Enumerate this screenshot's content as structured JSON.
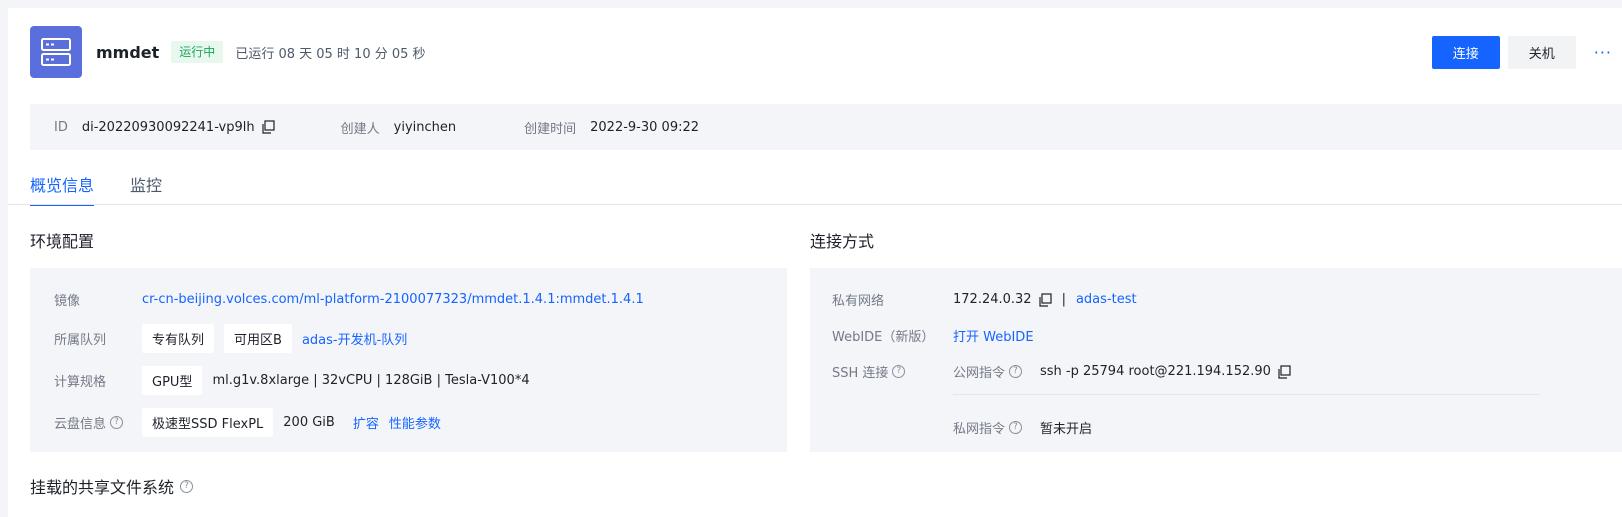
{
  "header": {
    "app_name": "mmdet",
    "status": "运行中",
    "uptime": "已运行 08 天 05 时 10 分 05 秒",
    "connect_label": "连接",
    "shutdown_label": "关机",
    "more_label": "···"
  },
  "meta": {
    "id_label": "ID",
    "id_value": "di-20220930092241-vp9lh",
    "creator_label": "创建人",
    "creator_value": "yiyinchen",
    "created_label": "创建时间",
    "created_value": "2022-9-30 09:22"
  },
  "tabs": [
    {
      "label": "概览信息",
      "active": true
    },
    {
      "label": "监控",
      "active": false
    }
  ],
  "env": {
    "title": "环境配置",
    "image_label": "镜像",
    "image_value": "cr-cn-beijing.volces.com/ml-platform-2100077323/mmdet.1.4.1:mmdet.1.4.1",
    "queue_label": "所属队列",
    "queue_tag1": "专有队列",
    "queue_tag2": "可用区B",
    "queue_link": "adas-开发机-队列",
    "compute_label": "计算规格",
    "compute_tag": "GPU型",
    "compute_value": "ml.g1v.8xlarge | 32vCPU | 128GiB | Tesla-V100*4",
    "disk_label": "云盘信息",
    "disk_tag": "极速型SSD FlexPL",
    "disk_size": "200 GiB",
    "disk_expand": "扩容",
    "disk_perf": "性能参数"
  },
  "connect": {
    "title": "连接方式",
    "private_net_label": "私有网络",
    "private_ip": "172.24.0.32",
    "private_sep": "|",
    "vpc_link": "adas-test",
    "webide_label": "WebIDE（新版）",
    "webide_link": "打开 WebIDE",
    "ssh_label": "SSH 连接",
    "public_cmd_label": "公网指令",
    "public_cmd_value": "ssh -p 25794 root@221.194.152.90",
    "private_cmd_label": "私网指令",
    "private_cmd_value": "暂未开启"
  },
  "shared_fs": {
    "title": "挂载的共享文件系统"
  },
  "colors": {
    "primary": "#1664ff",
    "status_green": "#1ba65a",
    "app_icon": "#5b6fdc"
  }
}
